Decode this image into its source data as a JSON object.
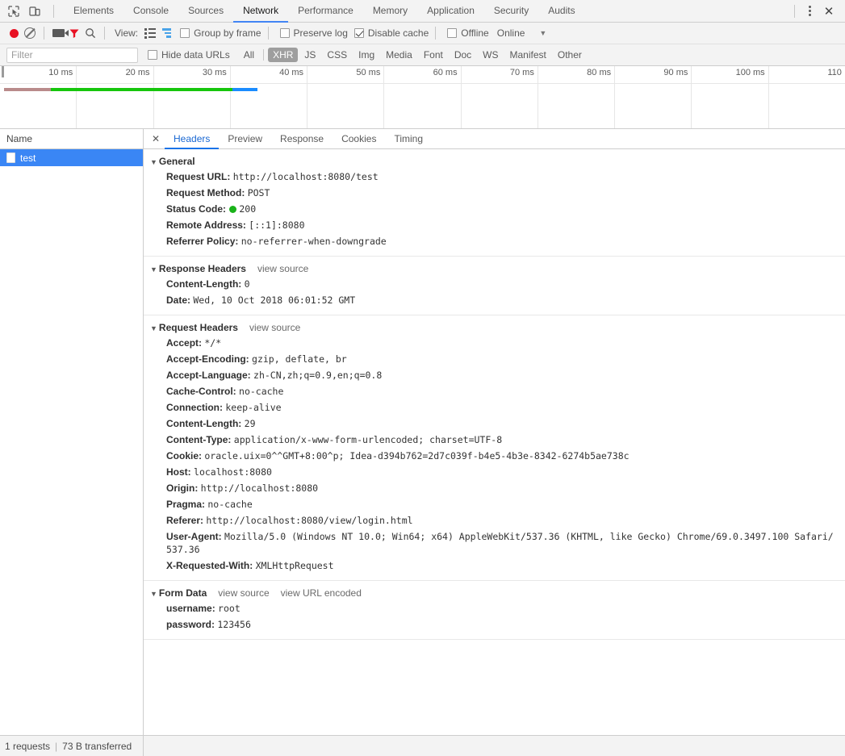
{
  "window": {
    "inspect_icon": "inspect-element-icon",
    "device_icon": "device-toolbar-icon",
    "menu_icon": "kebab-menu-icon",
    "close_icon": "close-icon"
  },
  "main_tabs": [
    {
      "label": "Elements",
      "active": false
    },
    {
      "label": "Console",
      "active": false
    },
    {
      "label": "Sources",
      "active": false
    },
    {
      "label": "Network",
      "active": true
    },
    {
      "label": "Performance",
      "active": false
    },
    {
      "label": "Memory",
      "active": false
    },
    {
      "label": "Application",
      "active": false
    },
    {
      "label": "Security",
      "active": false
    },
    {
      "label": "Audits",
      "active": false
    }
  ],
  "toolbar": {
    "record_icon": "record-button-icon",
    "clear_icon": "clear-icon",
    "screenshot_icon": "camera-icon",
    "filter_icon": "filter-funnel-icon",
    "search_icon": "search-icon",
    "view_label": "View:",
    "list_view_icon": "list-view-icon",
    "waterfall_view_icon": "waterfall-view-icon",
    "group_by_frame_label": "Group by frame",
    "group_by_frame_checked": false,
    "preserve_log_label": "Preserve log",
    "preserve_log_checked": false,
    "disable_cache_label": "Disable cache",
    "disable_cache_checked": true,
    "offline_label": "Offline",
    "offline_checked": false,
    "throttling_value": "Online",
    "throttling_caret": "▼"
  },
  "filterbar": {
    "filter_value": "",
    "filter_placeholder": "Filter",
    "hide_data_urls_label": "Hide data URLs",
    "hide_data_urls_checked": false,
    "types": [
      {
        "label": "All",
        "active": false
      },
      {
        "label": "XHR",
        "active": true
      },
      {
        "label": "JS",
        "active": false
      },
      {
        "label": "CSS",
        "active": false
      },
      {
        "label": "Img",
        "active": false
      },
      {
        "label": "Media",
        "active": false
      },
      {
        "label": "Font",
        "active": false
      },
      {
        "label": "Doc",
        "active": false
      },
      {
        "label": "WS",
        "active": false
      },
      {
        "label": "Manifest",
        "active": false
      },
      {
        "label": "Other",
        "active": false
      }
    ]
  },
  "overview": {
    "ticks": [
      "10 ms",
      "20 ms",
      "30 ms",
      "40 ms",
      "50 ms",
      "60 ms",
      "70 ms",
      "80 ms",
      "90 ms",
      "100 ms",
      "110"
    ],
    "bar": {
      "left_pct": 0.5,
      "stall_pct": 5.5,
      "download_pct": 21.5,
      "tail_pct": 3.0
    },
    "colors": {
      "stall": "#b98b8b",
      "download": "#16c60c",
      "tail": "#1a8cff"
    }
  },
  "requests_pane": {
    "column_header": "Name",
    "rows": [
      {
        "name": "test",
        "selected": true,
        "icon": "document-icon"
      }
    ]
  },
  "detail_tabs": [
    {
      "label": "Headers",
      "active": true
    },
    {
      "label": "Preview",
      "active": false
    },
    {
      "label": "Response",
      "active": false
    },
    {
      "label": "Cookies",
      "active": false
    },
    {
      "label": "Timing",
      "active": false
    }
  ],
  "sections": [
    {
      "title": "General",
      "links": [],
      "rows": [
        {
          "key": "Request URL:",
          "value": "http://localhost:8080/test"
        },
        {
          "key": "Request Method:",
          "value": "POST"
        },
        {
          "key": "Status Code:",
          "value": "200",
          "status_dot": true
        },
        {
          "key": "Remote Address:",
          "value": "[::1]:8080"
        },
        {
          "key": "Referrer Policy:",
          "value": "no-referrer-when-downgrade"
        }
      ]
    },
    {
      "title": "Response Headers",
      "links": [
        "view source"
      ],
      "rows": [
        {
          "key": "Content-Length:",
          "value": "0"
        },
        {
          "key": "Date:",
          "value": "Wed, 10 Oct 2018 06:01:52 GMT"
        }
      ]
    },
    {
      "title": "Request Headers",
      "links": [
        "view source"
      ],
      "rows": [
        {
          "key": "Accept:",
          "value": "*/*"
        },
        {
          "key": "Accept-Encoding:",
          "value": "gzip, deflate, br"
        },
        {
          "key": "Accept-Language:",
          "value": "zh-CN,zh;q=0.9,en;q=0.8"
        },
        {
          "key": "Cache-Control:",
          "value": "no-cache"
        },
        {
          "key": "Connection:",
          "value": "keep-alive"
        },
        {
          "key": "Content-Length:",
          "value": "29"
        },
        {
          "key": "Content-Type:",
          "value": "application/x-www-form-urlencoded; charset=UTF-8"
        },
        {
          "key": "Cookie:",
          "value": "oracle.uix=0^^GMT+8:00^p; Idea-d394b762=2d7c039f-b4e5-4b3e-8342-6274b5ae738c"
        },
        {
          "key": "Host:",
          "value": "localhost:8080"
        },
        {
          "key": "Origin:",
          "value": "http://localhost:8080"
        },
        {
          "key": "Pragma:",
          "value": "no-cache"
        },
        {
          "key": "Referer:",
          "value": "http://localhost:8080/view/login.html"
        },
        {
          "key": "User-Agent:",
          "value": "Mozilla/5.0 (Windows NT 10.0; Win64; x64) AppleWebKit/537.36 (KHTML, like Gecko) Chrome/69.0.3497.100 Safari/537.36"
        },
        {
          "key": "X-Requested-With:",
          "value": "XMLHttpRequest"
        }
      ]
    },
    {
      "title": "Form Data",
      "links": [
        "view source",
        "view URL encoded"
      ],
      "rows": [
        {
          "key": "username:",
          "value": "root"
        },
        {
          "key": "password:",
          "value": "123456"
        }
      ]
    }
  ],
  "footer": {
    "requests_text": "1 requests",
    "separator": "|",
    "transferred_text": "73 B transferred"
  }
}
